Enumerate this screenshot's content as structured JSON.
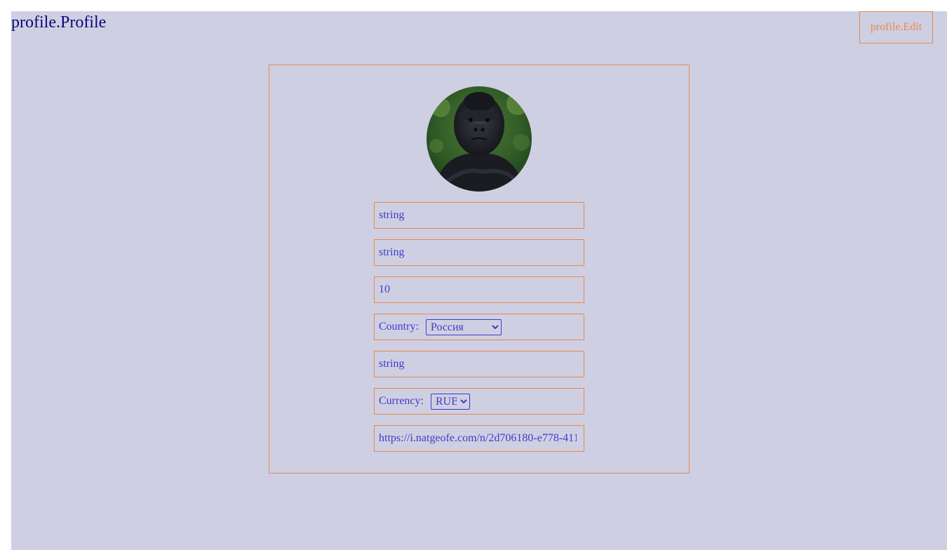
{
  "header": {
    "title": "profile.Profile",
    "edit_label": "profile.Edit"
  },
  "profile": {
    "avatar_icon": "gorilla-avatar-image",
    "first_name": "string",
    "last_name": "string",
    "age": "10",
    "country_label": "Country:",
    "country_selected": "Россия",
    "city": "string",
    "currency_label": "Currency:",
    "currency_selected": "RUB",
    "avatar_url": "https://i.natgeofe.com/n/2d706180-e778-411"
  },
  "colors": {
    "background": "#cfcfe3",
    "accent": "#e58a4a",
    "text": "#3d3dc8",
    "title": "#0a0a7a"
  }
}
